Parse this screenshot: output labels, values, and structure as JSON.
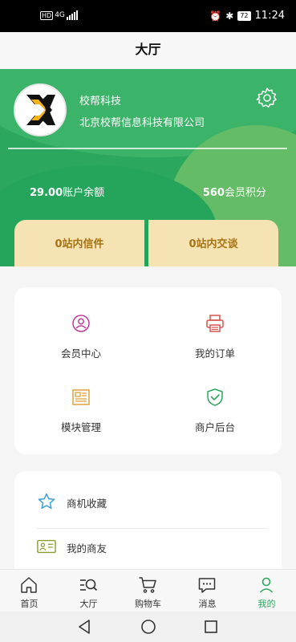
{
  "status_bar": {
    "hd": "HD",
    "network": "4G",
    "battery": "72",
    "time": "11:24"
  },
  "header": {
    "title": "大厅"
  },
  "profile": {
    "short_name": "校帮科技",
    "full_name": "北京校帮信息科技有限公司"
  },
  "stats": {
    "balance_value": "29.00",
    "balance_label": "账户余额",
    "points_value": "560",
    "points_label": "会员积分"
  },
  "messages": {
    "inbox": "0站内信件",
    "chat": "0站内交谈"
  },
  "features": [
    {
      "label": "会员中心",
      "icon": "member-icon",
      "color": "#c0399b"
    },
    {
      "label": "我的订单",
      "icon": "printer-icon",
      "color": "#d9534f"
    },
    {
      "label": "模块管理",
      "icon": "module-icon",
      "color": "#e0a13a"
    },
    {
      "label": "商户后台",
      "icon": "shield-check-icon",
      "color": "#2ba85e"
    }
  ],
  "list": [
    {
      "label": "商机收藏",
      "icon": "star-icon",
      "color": "#3aa0d8"
    },
    {
      "label": "我的商友",
      "icon": "contact-card-icon",
      "color": "#8a9a2b"
    }
  ],
  "tabs": [
    {
      "label": "首页",
      "icon": "home-icon"
    },
    {
      "label": "大厅",
      "icon": "hall-search-icon"
    },
    {
      "label": "购物车",
      "icon": "cart-icon"
    },
    {
      "label": "消息",
      "icon": "message-icon"
    },
    {
      "label": "我的",
      "icon": "profile-icon",
      "active": true
    }
  ],
  "colors": {
    "brand_green": "#2ba85e",
    "card_tan": "#f6e3b3",
    "card_text": "#a57214"
  }
}
